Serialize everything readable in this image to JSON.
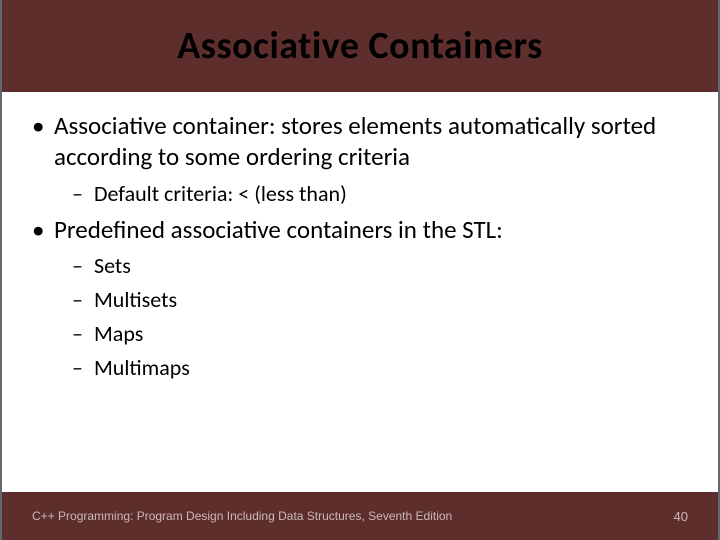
{
  "title": "Associative Containers",
  "bullets": [
    {
      "text": "Associative container: stores elements automatically sorted according to some ordering criteria",
      "children": [
        {
          "text": "Default criteria: < (less than)"
        }
      ]
    },
    {
      "text": "Predefined associative containers in the STL:",
      "children": [
        {
          "text": "Sets"
        },
        {
          "text": "Multisets"
        },
        {
          "text": "Maps"
        },
        {
          "text": "Multimaps"
        }
      ]
    }
  ],
  "footer": {
    "text": "C++ Programming: Program Design Including Data Structures, Seventh Edition",
    "page_number": "40"
  }
}
